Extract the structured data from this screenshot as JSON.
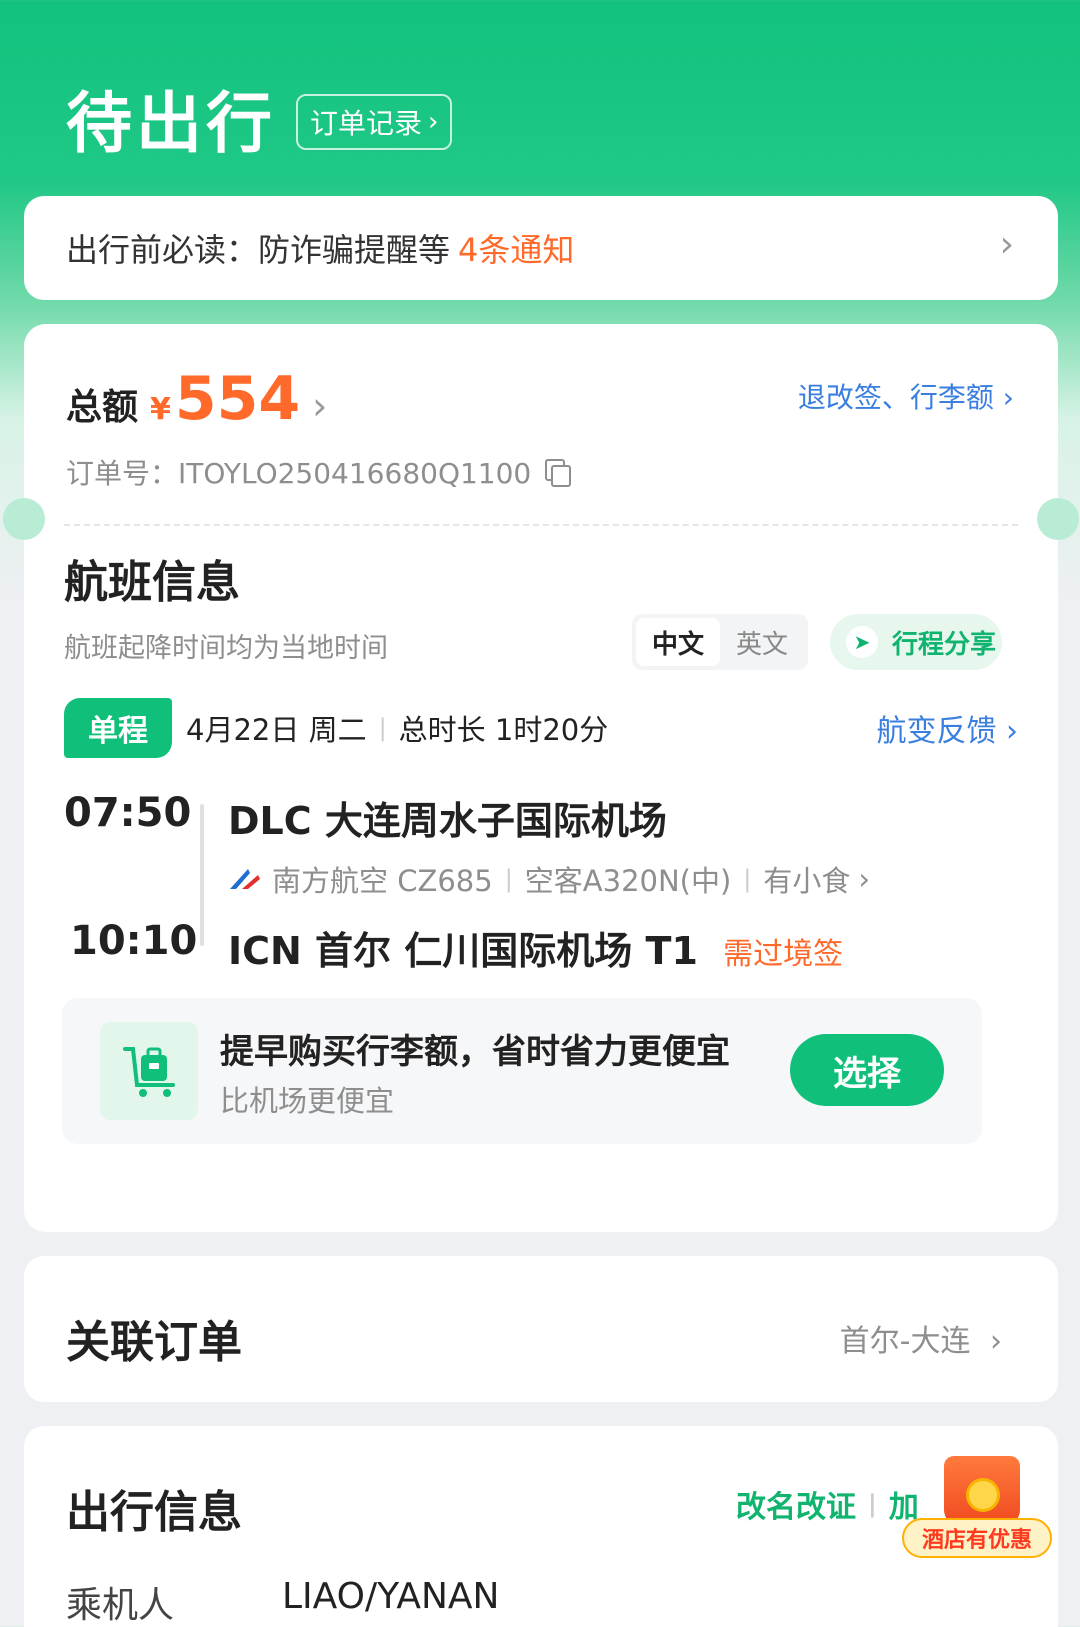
{
  "header": {
    "title": "待出行",
    "order_record": "订单记录"
  },
  "notice": {
    "text": "出行前必读：防诈骗提醒等",
    "count": "4条通知"
  },
  "order": {
    "total_label": "总额",
    "currency": "¥",
    "amount": "554",
    "refund_link": "退改签、行李额",
    "order_no": "订单号：ITOYLO250416680Q1100"
  },
  "flight": {
    "section_title": "航班信息",
    "local_time_note": "航班起降时间均为当地时间",
    "lang_zh": "中文",
    "lang_en": "英文",
    "share": "行程分享",
    "trip_type": "单程",
    "date": "4月22日 周二",
    "duration": "总时长 1时20分",
    "change_feedback": "航变反馈",
    "departure_time": "07:50",
    "departure_airport": "DLC 大连周水子国际机场",
    "airline": "南方航空 CZ685",
    "aircraft": "空客A320N(中)",
    "meal": "有小食",
    "arrival_time": "10:10",
    "arrival_airport": "ICN 首尔 仁川国际机场 T1",
    "visa_note": "需过境签"
  },
  "baggage": {
    "title": "提早购买行李额，省时省力更便宜",
    "subtitle": "比机场更便宜",
    "button": "选择"
  },
  "related": {
    "title": "关联订单",
    "route": "首尔-大连"
  },
  "travel": {
    "title": "出行信息",
    "rename_link": "改名改证",
    "add_link": "加",
    "passenger_label": "乘机人",
    "passenger_name": "LIAO/YANAN"
  },
  "promo": {
    "label": "酒店有优惠"
  },
  "colors": {
    "brand_green": "#10c07a",
    "price_orange": "#ff6a2b",
    "link_blue": "#3a7fe0"
  }
}
